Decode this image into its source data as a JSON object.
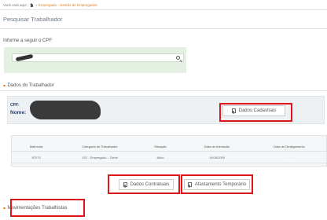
{
  "breadcrumb": {
    "prefix": "Você está aqui :",
    "path": "» Empregado › Gestão de Empregados"
  },
  "page_title": "Pesquisar Trabalhador",
  "cpf_search": {
    "label": "Informe a seguir o CPF"
  },
  "worker_section": {
    "title": "Dados do Trabalhador",
    "cpf_label": "CPF:",
    "name_label": "Nome:",
    "cadastrais_button": "Dados Cadastrais"
  },
  "contracts_table": {
    "columns": [
      "Matrícula",
      "Categoria do Trabalhador",
      "Situação",
      "Data de Admissão",
      "Data do Desligamento"
    ],
    "rows": [
      {
        "matricula": "87073",
        "categoria": "101 - Empregado – Geral",
        "situacao": "Ativo",
        "admissao": "14/06/2000",
        "desligamento": "-"
      }
    ]
  },
  "actions": {
    "contratuais_button": "Dados Contratuais",
    "afastamento_button": "Afastamento Temporário"
  },
  "movimentacoes": {
    "title": "Movimentações Trabalhistas"
  },
  "colors": {
    "accent": "#d9822b",
    "highlight": "#e0151c",
    "search_panel": "#e3f0e2",
    "label_navy": "#2c3e63"
  }
}
